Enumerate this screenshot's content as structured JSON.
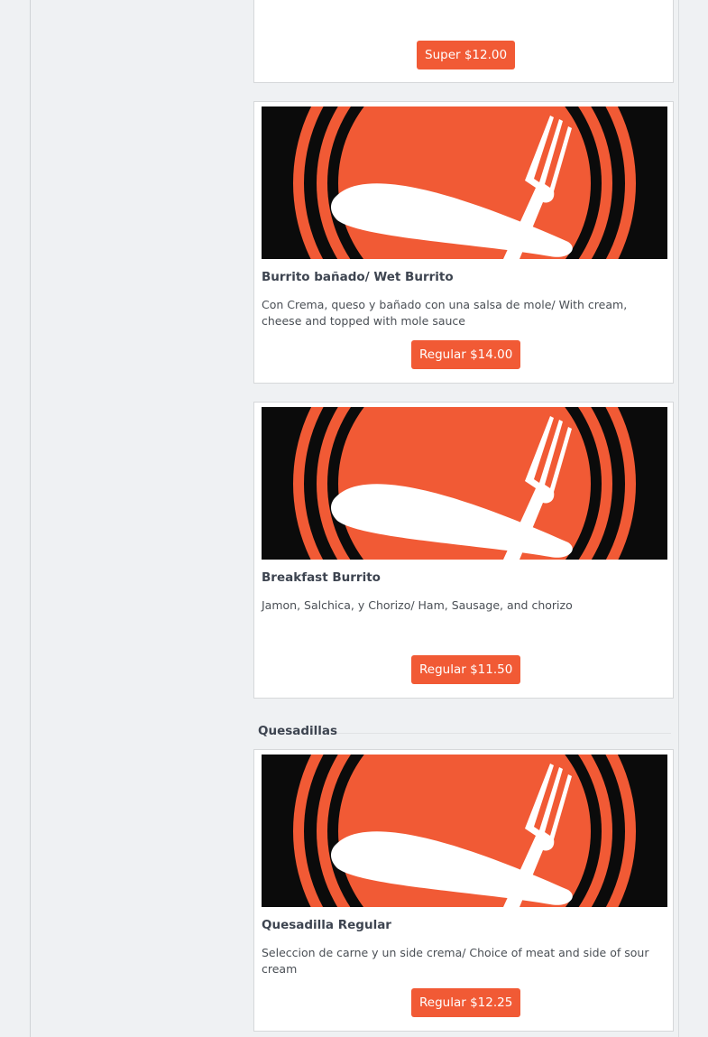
{
  "top_card": {
    "price_label": "Super $12.00"
  },
  "items": [
    {
      "name": "Burrito bañado/ Wet Burrito",
      "description": "Con Crema, queso y bañado con una salsa de mole/ With cream, cheese and topped with mole sauce",
      "price_label": "Regular $14.00",
      "image_icon": "knife-and-fork-plate-logo"
    },
    {
      "name": "Breakfast Burrito",
      "description": "Jamon, Salchica, y Chorizo/ Ham, Sausage, and chorizo",
      "price_label": "Regular $11.50",
      "image_icon": "knife-and-fork-plate-logo"
    },
    {
      "name": "Quesadilla Regular",
      "description": "Seleccion de carne y un side crema/ Choice of meat and side of sour cream",
      "price_label": "Regular $12.25",
      "image_icon": "knife-and-fork-plate-logo"
    }
  ],
  "sections": [
    {
      "title": "Quesadillas"
    }
  ],
  "colors": {
    "accent": "#f15a35",
    "image_bg": "#0b0b0b",
    "page_bg": "#eff1f3"
  }
}
